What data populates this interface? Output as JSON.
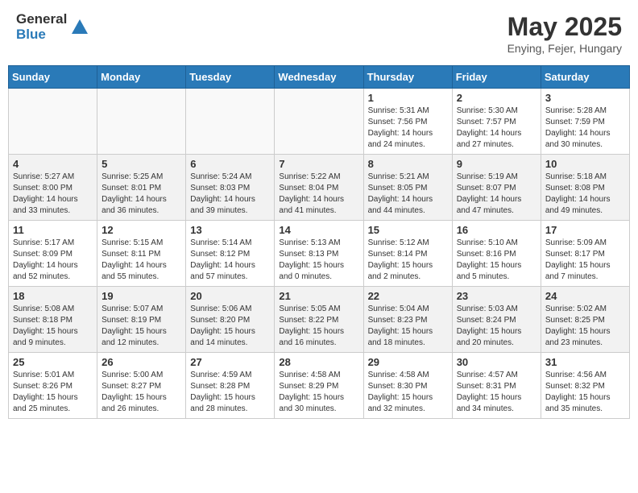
{
  "logo": {
    "line1": "General",
    "line2": "Blue"
  },
  "title": "May 2025",
  "subtitle": "Enying, Fejer, Hungary",
  "days_of_week": [
    "Sunday",
    "Monday",
    "Tuesday",
    "Wednesday",
    "Thursday",
    "Friday",
    "Saturday"
  ],
  "weeks": [
    [
      {
        "day": "",
        "info": ""
      },
      {
        "day": "",
        "info": ""
      },
      {
        "day": "",
        "info": ""
      },
      {
        "day": "",
        "info": ""
      },
      {
        "day": "1",
        "info": "Sunrise: 5:31 AM\nSunset: 7:56 PM\nDaylight: 14 hours\nand 24 minutes."
      },
      {
        "day": "2",
        "info": "Sunrise: 5:30 AM\nSunset: 7:57 PM\nDaylight: 14 hours\nand 27 minutes."
      },
      {
        "day": "3",
        "info": "Sunrise: 5:28 AM\nSunset: 7:59 PM\nDaylight: 14 hours\nand 30 minutes."
      }
    ],
    [
      {
        "day": "4",
        "info": "Sunrise: 5:27 AM\nSunset: 8:00 PM\nDaylight: 14 hours\nand 33 minutes."
      },
      {
        "day": "5",
        "info": "Sunrise: 5:25 AM\nSunset: 8:01 PM\nDaylight: 14 hours\nand 36 minutes."
      },
      {
        "day": "6",
        "info": "Sunrise: 5:24 AM\nSunset: 8:03 PM\nDaylight: 14 hours\nand 39 minutes."
      },
      {
        "day": "7",
        "info": "Sunrise: 5:22 AM\nSunset: 8:04 PM\nDaylight: 14 hours\nand 41 minutes."
      },
      {
        "day": "8",
        "info": "Sunrise: 5:21 AM\nSunset: 8:05 PM\nDaylight: 14 hours\nand 44 minutes."
      },
      {
        "day": "9",
        "info": "Sunrise: 5:19 AM\nSunset: 8:07 PM\nDaylight: 14 hours\nand 47 minutes."
      },
      {
        "day": "10",
        "info": "Sunrise: 5:18 AM\nSunset: 8:08 PM\nDaylight: 14 hours\nand 49 minutes."
      }
    ],
    [
      {
        "day": "11",
        "info": "Sunrise: 5:17 AM\nSunset: 8:09 PM\nDaylight: 14 hours\nand 52 minutes."
      },
      {
        "day": "12",
        "info": "Sunrise: 5:15 AM\nSunset: 8:11 PM\nDaylight: 14 hours\nand 55 minutes."
      },
      {
        "day": "13",
        "info": "Sunrise: 5:14 AM\nSunset: 8:12 PM\nDaylight: 14 hours\nand 57 minutes."
      },
      {
        "day": "14",
        "info": "Sunrise: 5:13 AM\nSunset: 8:13 PM\nDaylight: 15 hours\nand 0 minutes."
      },
      {
        "day": "15",
        "info": "Sunrise: 5:12 AM\nSunset: 8:14 PM\nDaylight: 15 hours\nand 2 minutes."
      },
      {
        "day": "16",
        "info": "Sunrise: 5:10 AM\nSunset: 8:16 PM\nDaylight: 15 hours\nand 5 minutes."
      },
      {
        "day": "17",
        "info": "Sunrise: 5:09 AM\nSunset: 8:17 PM\nDaylight: 15 hours\nand 7 minutes."
      }
    ],
    [
      {
        "day": "18",
        "info": "Sunrise: 5:08 AM\nSunset: 8:18 PM\nDaylight: 15 hours\nand 9 minutes."
      },
      {
        "day": "19",
        "info": "Sunrise: 5:07 AM\nSunset: 8:19 PM\nDaylight: 15 hours\nand 12 minutes."
      },
      {
        "day": "20",
        "info": "Sunrise: 5:06 AM\nSunset: 8:20 PM\nDaylight: 15 hours\nand 14 minutes."
      },
      {
        "day": "21",
        "info": "Sunrise: 5:05 AM\nSunset: 8:22 PM\nDaylight: 15 hours\nand 16 minutes."
      },
      {
        "day": "22",
        "info": "Sunrise: 5:04 AM\nSunset: 8:23 PM\nDaylight: 15 hours\nand 18 minutes."
      },
      {
        "day": "23",
        "info": "Sunrise: 5:03 AM\nSunset: 8:24 PM\nDaylight: 15 hours\nand 20 minutes."
      },
      {
        "day": "24",
        "info": "Sunrise: 5:02 AM\nSunset: 8:25 PM\nDaylight: 15 hours\nand 23 minutes."
      }
    ],
    [
      {
        "day": "25",
        "info": "Sunrise: 5:01 AM\nSunset: 8:26 PM\nDaylight: 15 hours\nand 25 minutes."
      },
      {
        "day": "26",
        "info": "Sunrise: 5:00 AM\nSunset: 8:27 PM\nDaylight: 15 hours\nand 26 minutes."
      },
      {
        "day": "27",
        "info": "Sunrise: 4:59 AM\nSunset: 8:28 PM\nDaylight: 15 hours\nand 28 minutes."
      },
      {
        "day": "28",
        "info": "Sunrise: 4:58 AM\nSunset: 8:29 PM\nDaylight: 15 hours\nand 30 minutes."
      },
      {
        "day": "29",
        "info": "Sunrise: 4:58 AM\nSunset: 8:30 PM\nDaylight: 15 hours\nand 32 minutes."
      },
      {
        "day": "30",
        "info": "Sunrise: 4:57 AM\nSunset: 8:31 PM\nDaylight: 15 hours\nand 34 minutes."
      },
      {
        "day": "31",
        "info": "Sunrise: 4:56 AM\nSunset: 8:32 PM\nDaylight: 15 hours\nand 35 minutes."
      }
    ]
  ]
}
